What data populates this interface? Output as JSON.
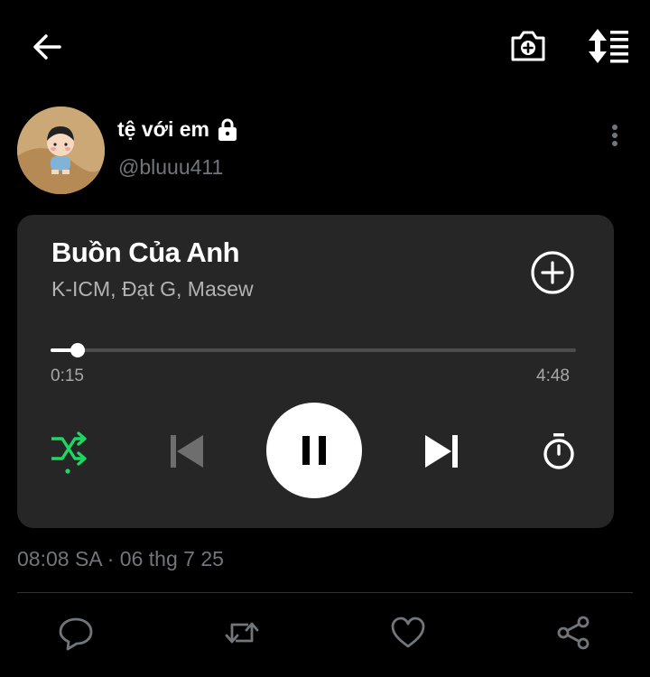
{
  "header": {
    "back_icon": "arrow-left-icon",
    "camera_icon": "camera-plus-icon",
    "sort_icon": "sort-list-icon"
  },
  "post": {
    "author": {
      "display_name": "tệ với em",
      "handle": "@bluuu411",
      "lock_icon": "lock-icon",
      "avatar": "avatar-image"
    },
    "more_icon": "more-vertical-icon",
    "timestamp": "08:08 SA · 06 thg 7 25"
  },
  "player": {
    "title": "Buồn Của Anh",
    "artists": "K-ICM, Đạt G, Masew",
    "elapsed": "0:15",
    "duration": "4:48",
    "progress": 0.052,
    "controls": {
      "shuffle_icon": "shuffle-icon",
      "previous_icon": "skip-previous-icon",
      "pause_icon": "pause-icon",
      "next_icon": "skip-next-icon",
      "timer_icon": "timer-icon",
      "add_icon": "add-circle-icon"
    },
    "colors": {
      "card": "#262626",
      "shuffle_active": "#1ed760"
    }
  },
  "actions": {
    "reply_icon": "reply-icon",
    "retweet_icon": "retweet-icon",
    "like_icon": "heart-icon",
    "share_icon": "share-icon"
  }
}
